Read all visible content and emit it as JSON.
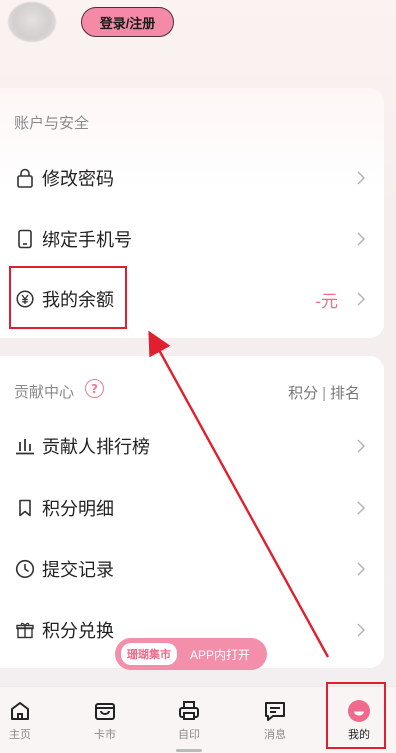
{
  "header": {
    "login_label": "登录/注册"
  },
  "account_section": {
    "title": "账户与安全",
    "items": [
      {
        "label": "修改密码",
        "icon": "lock-icon"
      },
      {
        "label": "绑定手机号",
        "icon": "phone-icon"
      },
      {
        "label": "我的余额",
        "icon": "yen-icon",
        "value": "-元"
      }
    ]
  },
  "contribution_section": {
    "title": "贡献中心",
    "help_glyph": "?",
    "links": [
      "积分",
      "排名"
    ],
    "links_separator": "|",
    "items": [
      {
        "label": "贡献人排行榜",
        "icon": "bar-chart-icon"
      },
      {
        "label": "积分明细",
        "icon": "bookmark-icon"
      },
      {
        "label": "提交记录",
        "icon": "clock-icon"
      },
      {
        "label": "积分兑换",
        "icon": "gift-icon"
      }
    ]
  },
  "app_banner": {
    "brand": "珊瑚集市",
    "action": "APP内打开"
  },
  "bottom_nav": [
    {
      "label": "主页",
      "icon": "home-icon"
    },
    {
      "label": "卡市",
      "icon": "bag-icon"
    },
    {
      "label": "自印",
      "icon": "printer-icon"
    },
    {
      "label": "消息",
      "icon": "message-icon"
    },
    {
      "label": "我的",
      "icon": "profile-icon",
      "active": true
    }
  ],
  "colors": {
    "accent": "#f06a8c",
    "login_button": "#f58aa8",
    "annotation": "#e0202e"
  }
}
